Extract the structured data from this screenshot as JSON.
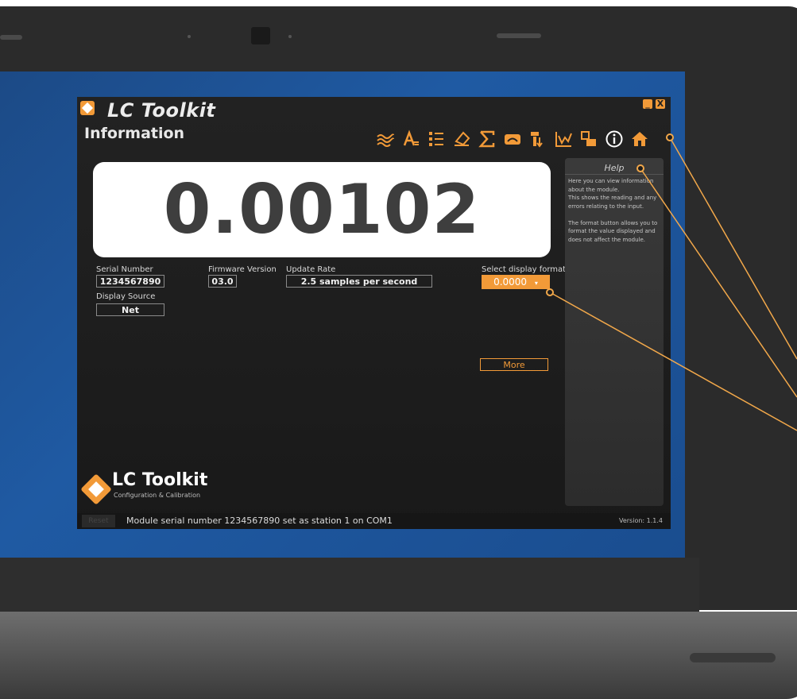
{
  "app": {
    "title": "LC Toolkit",
    "page_title": "Information",
    "minimize_label": "_",
    "close_label": "X"
  },
  "toolbar": {
    "icons": [
      "trend-icon",
      "calibration-icon",
      "list-icon",
      "eraser-icon",
      "sigma-icon",
      "gauge-icon",
      "download-icon",
      "chart-icon",
      "files-icon",
      "info-icon",
      "home-icon"
    ]
  },
  "readout": {
    "value": "0.00102"
  },
  "fields": {
    "serial_label": "Serial Number",
    "serial_value": "1234567890",
    "firmware_label": "Firmware Version",
    "firmware_value": "03.0",
    "rate_label": "Update Rate",
    "rate_value": "2.5 samples per second",
    "source_label": "Display Source",
    "source_value": "Net",
    "format_label": "Select display format",
    "format_value": "0.0000"
  },
  "more_label": "More",
  "help": {
    "title": "Help",
    "text": "Here you can view information about the module.\nThis shows the reading and any errors relating to the input.\n\nThe format button allows you to format the value displayed and does not affect the module."
  },
  "brand": {
    "name": "LC Toolkit",
    "subtitle": "Configuration & Calibration"
  },
  "status": {
    "reset_label": "Reset",
    "message": "Module serial number 1234567890 set as station 1 on COM1",
    "version": "Version: 1.1.4"
  },
  "colors": {
    "accent": "#f29a38",
    "background": "#1d1d1d",
    "desktop": "#1f5aa3"
  }
}
